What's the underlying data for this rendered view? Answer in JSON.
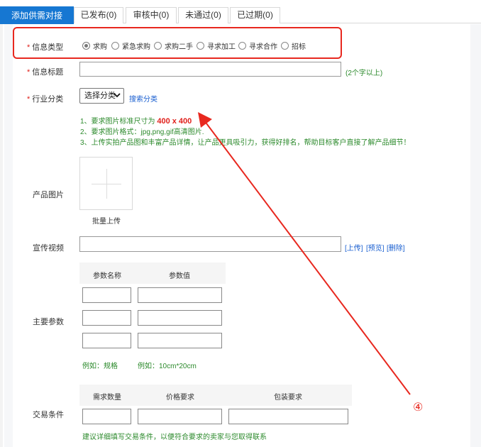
{
  "tabs": [
    {
      "label": "添加供需对接",
      "active": true
    },
    {
      "label": "已发布(0)",
      "active": false
    },
    {
      "label": "审核中(0)",
      "active": false
    },
    {
      "label": "未通过(0)",
      "active": false
    },
    {
      "label": "已过期(0)",
      "active": false
    }
  ],
  "form": {
    "required_mark": "*",
    "info_type": {
      "label": "信息类型",
      "options": [
        "求购",
        "紧急求购",
        "求购二手",
        "寻求加工",
        "寻求合作",
        "招标"
      ],
      "selected": "求购"
    },
    "info_title": {
      "label": "信息标题",
      "value": "",
      "hint": "(2个字以上)"
    },
    "industry": {
      "label": "行业分类",
      "selected": "选择分类",
      "search_link": "搜索分类"
    },
    "image_notes": {
      "line1_prefix": "1、要求图片标准尺寸为",
      "line1_size": "400 x 400",
      "line2": "2、要求图片格式：jpg,png,gif高清图片.",
      "line3": "3、上传实拍产品图和丰富产品详情，让产品更具吸引力，获得好排名，帮助目标客户直接了解产品细节！"
    },
    "product_image": {
      "label": "产品图片",
      "batch_upload": "批量上传"
    },
    "video": {
      "label": "宣传视频",
      "value": "",
      "upload": "[上传]",
      "preview": "[预览]",
      "delete": "[删除]"
    },
    "params": {
      "label": "主要参数",
      "col_name": "参数名称",
      "col_value": "参数值",
      "example_name": "例如：规格",
      "example_value": "例如：10cm*20cm"
    },
    "trade": {
      "label": "交易条件",
      "col_qty": "需求数量",
      "col_price": "价格要求",
      "col_pack": "包装要求",
      "hint": "建议详细填写交易条件，以便符合要求的卖家与您取得联系"
    }
  },
  "annotation": {
    "number": "④",
    "color": "#e8281f"
  },
  "colors": {
    "accent": "#1677d2",
    "green": "#2c8a2c",
    "red": "#e0201b",
    "link": "#1a5fd0"
  }
}
